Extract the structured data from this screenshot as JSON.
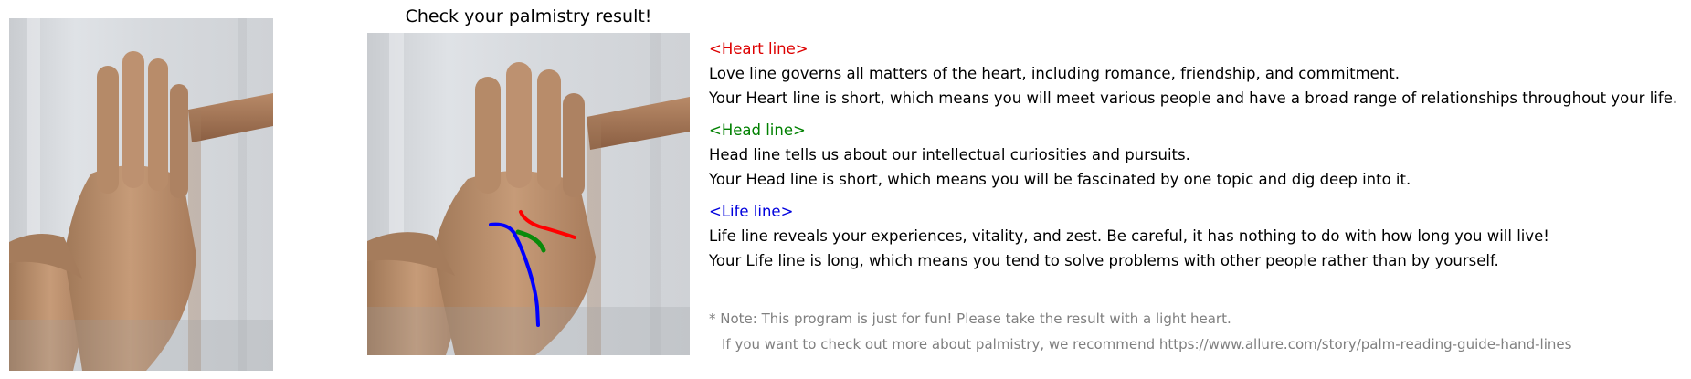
{
  "title": "Check your palmistry result!",
  "sections": [
    {
      "heading": "<Heart line>",
      "color": "#dd0000",
      "line1": "Love line governs all matters of the heart, including romance, friendship, and commitment.",
      "line2": "Your Heart line is short, which means you will meet various people and have a broad range of relationships throughout your life."
    },
    {
      "heading": "<Head line>",
      "color": "#008000",
      "line1": "Head line tells us about our intellectual curiosities and pursuits.",
      "line2": "Your Head line is short, which means you will be fascinated by one topic and dig deep into it."
    },
    {
      "heading": "<Life line>",
      "color": "#0000dd",
      "line1": "Life line reveals your experiences, vitality, and zest. Be careful, it has nothing to do with how long you will live!",
      "line2": "Your Life line is long, which means you tend to solve problems with other people rather than by yourself."
    }
  ],
  "notes": {
    "note1": "* Note: This program is just for fun! Please take the result with a light heart.",
    "note2": "If you want to check out more about palmistry, we recommend https://www.allure.com/story/palm-reading-guide-hand-lines"
  },
  "overlay_colors": {
    "heart": "#ff0000",
    "head": "#0a8a0a",
    "life": "#0000ff"
  },
  "text_color_notes": "#7f7f7f"
}
